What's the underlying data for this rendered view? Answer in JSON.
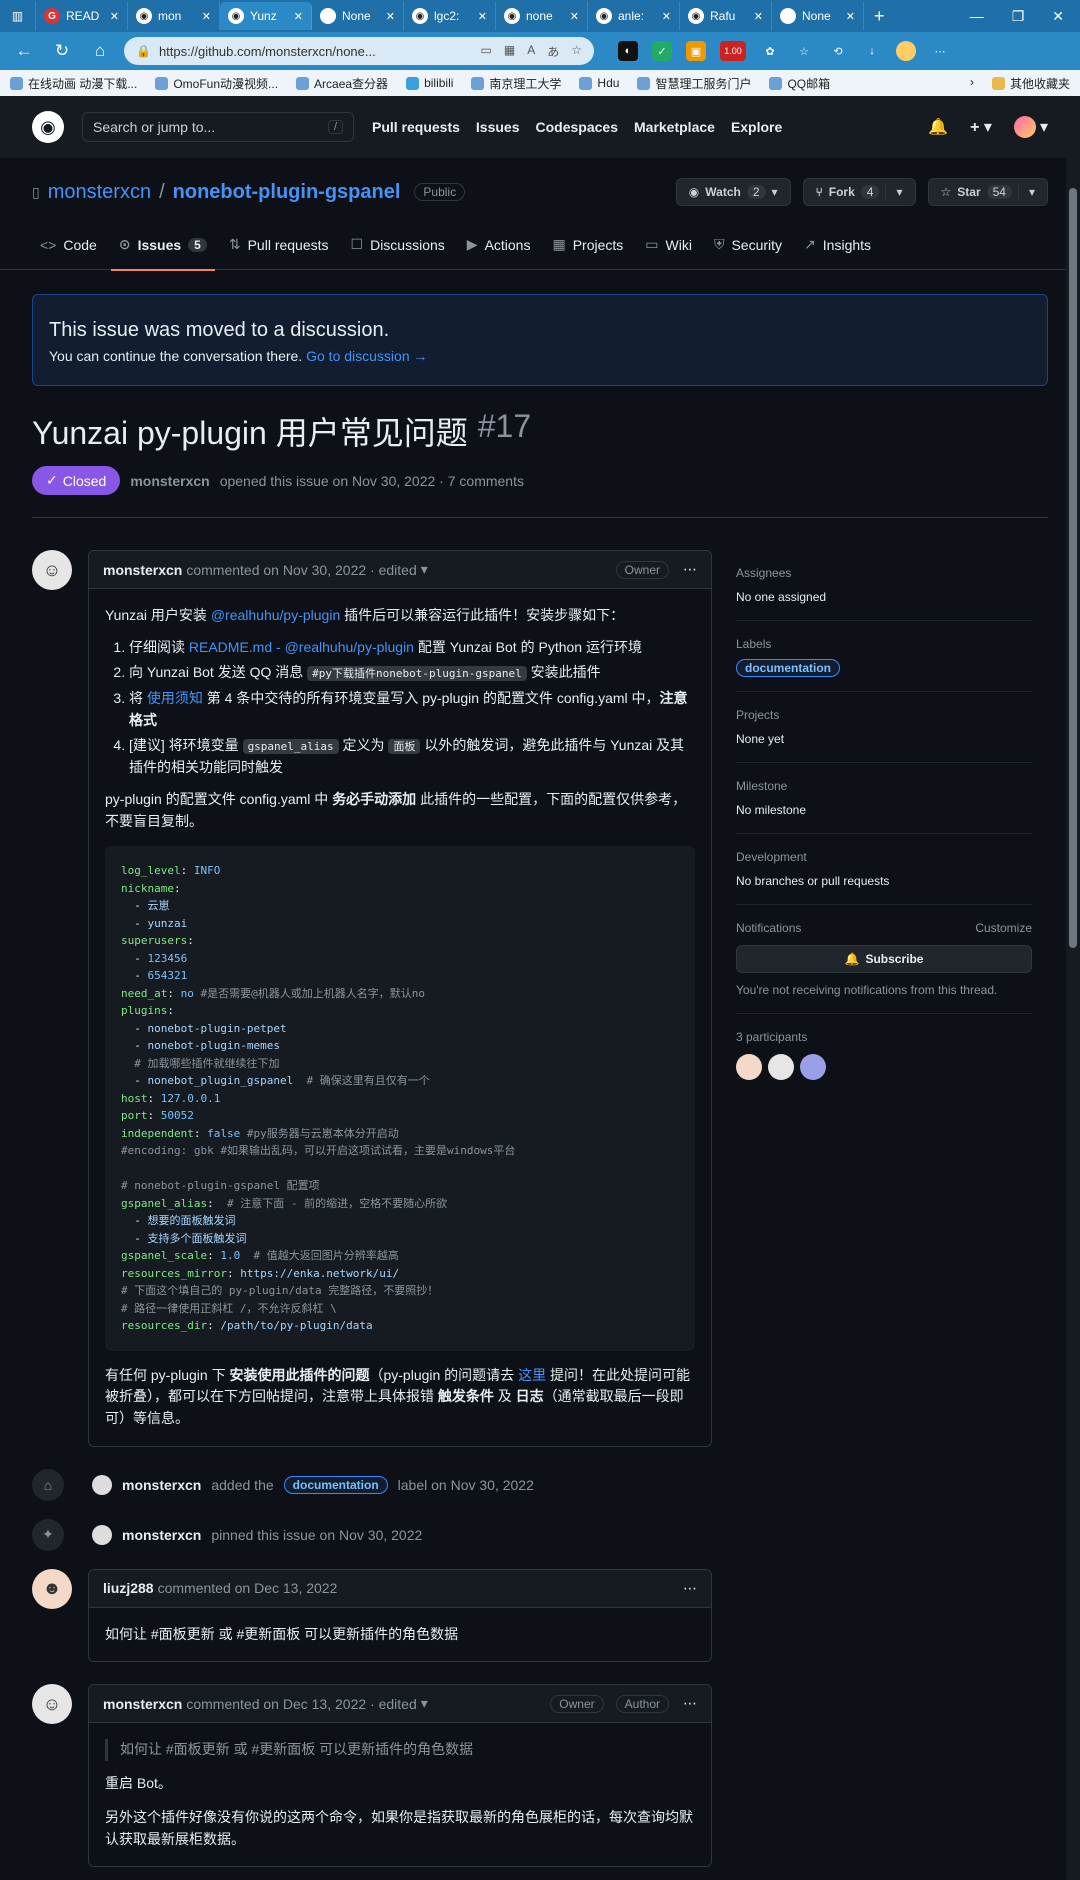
{
  "browser": {
    "tabs": [
      {
        "label": "READ",
        "icon": "G",
        "active": false
      },
      {
        "label": "mon",
        "icon": "◉",
        "active": false
      },
      {
        "label": "Yunz",
        "icon": "◉",
        "active": true
      },
      {
        "label": "None",
        "icon": "",
        "active": false
      },
      {
        "label": "lgc2:",
        "icon": "◉",
        "active": false
      },
      {
        "label": "none",
        "icon": "◉",
        "active": false
      },
      {
        "label": "anle:",
        "icon": "◉",
        "active": false
      },
      {
        "label": "Rafu",
        "icon": "◉",
        "active": false
      },
      {
        "label": "None",
        "icon": "",
        "active": false
      }
    ],
    "url": "https://github.com/monsterxcn/none...",
    "bookmarks": [
      "在线动画 动漫下载...",
      "OmoFun动漫视频...",
      "Arcaea查分器",
      "bilibili",
      "南京理工大学",
      "Hdu",
      "智慧理工服务门户",
      "QQ邮箱"
    ],
    "bookmarks_more": "其他收藏夹",
    "ext_badge": "1.00"
  },
  "gh": {
    "search_placeholder": "Search or jump to...",
    "search_key": "/",
    "nav": [
      "Pull requests",
      "Issues",
      "Codespaces",
      "Marketplace",
      "Explore"
    ]
  },
  "repo": {
    "owner": "monsterxcn",
    "sep": "/",
    "name": "nonebot-plugin-gspanel",
    "visibility": "Public",
    "watch_label": "Watch",
    "watch_count": "2",
    "fork_label": "Fork",
    "fork_count": "4",
    "star_label": "Star",
    "star_count": "54",
    "tabs": [
      {
        "label": "Code",
        "icon": "<>"
      },
      {
        "label": "Issues",
        "icon": "⊙",
        "count": "5",
        "active": true
      },
      {
        "label": "Pull requests",
        "icon": "⇅"
      },
      {
        "label": "Discussions",
        "icon": "☐"
      },
      {
        "label": "Actions",
        "icon": "▶"
      },
      {
        "label": "Projects",
        "icon": "▦"
      },
      {
        "label": "Wiki",
        "icon": "▭"
      },
      {
        "label": "Security",
        "icon": "⛨"
      },
      {
        "label": "Insights",
        "icon": "↗"
      }
    ]
  },
  "moved": {
    "title": "This issue was moved to a discussion.",
    "text": "You can continue the conversation there.",
    "link": "Go to discussion →"
  },
  "issue": {
    "title": "Yunzai py-plugin 用户常见问题",
    "number": "#17",
    "state": "Closed",
    "author": "monsterxcn",
    "opened_text": "opened this issue on Nov 30, 2022 · 7 comments"
  },
  "comment1": {
    "author": "monsterxcn",
    "meta": "commented on Nov 30, 2022 · edited",
    "role": "Owner",
    "intro_pre": "Yunzai 用户安装 ",
    "intro_link": "@realhuhu/py-plugin",
    "intro_post": " 插件后可以兼容运行此插件！安装步骤如下：",
    "step1_pre": "仔细阅读 ",
    "step1_link": "README.md - @realhuhu/py-plugin",
    "step1_post": " 配置 Yunzai Bot 的 Python 运行环境",
    "step2_pre": "向 Yunzai Bot 发送 QQ 消息 ",
    "step2_code": "#py下载插件nonebot-plugin-gspanel",
    "step2_post": " 安装此插件",
    "step3_pre": "将 ",
    "step3_link": "使用须知",
    "step3_mid": " 第 4 条中交待的所有环境变量写入 py-plugin 的配置文件 config.yaml 中，",
    "step3_bold": "注意格式",
    "step4_pre": "[建议] 将环境变量 ",
    "step4_code1": "gspanel_alias",
    "step4_mid": " 定义为 ",
    "step4_code2": "面板",
    "step4_post": " 以外的触发词，避免此插件与 Yunzai 及其插件的相关功能同时触发",
    "para2_pre": "py-plugin 的配置文件 config.yaml 中 ",
    "para2_bold": "务必手动添加",
    "para2_post": " 此插件的一些配置，下面的配置仅供参考，不要盲目复制。",
    "para3_pre": "有任何 py-plugin 下 ",
    "para3_bold": "安装使用此插件的问题",
    "para3_mid": "（py-plugin 的问题请去 ",
    "para3_link": "这里",
    "para3_mid2": " 提问！在此处提问可能被折叠），都可以在下方回帖提问，注意带上具体报错 ",
    "para3_b2": "触发条件",
    "para3_and": " 及 ",
    "para3_b3": "日志",
    "para3_post": "（通常截取最后一段即可）等信息。"
  },
  "events": [
    {
      "actor": "monsterxcn",
      "pre": "added the",
      "label": "documentation",
      "post": "label on Nov 30, 2022",
      "icon": "tag-icon"
    },
    {
      "actor": "monsterxcn",
      "pre": "pinned this issue on Nov 30, 2022",
      "label": "",
      "post": "",
      "icon": "pin-icon"
    }
  ],
  "comment2": {
    "author": "liuzj288",
    "meta": "commented on Dec 13, 2022",
    "body": "如何让 #面板更新 或 #更新面板 可以更新插件的角色数据"
  },
  "comment3": {
    "author": "monsterxcn",
    "meta": "commented on Dec 13, 2022 · edited",
    "role1": "Owner",
    "role2": "Author",
    "quote": "如何让 #面板更新 或 #更新面板 可以更新插件的角色数据",
    "p1": "重启 Bot。",
    "p2": "另外这个插件好像没有你说的这两个命令，如果你是指获取最新的角色展柜的话，每次查询均默认获取最新展柜数据。"
  },
  "sidebar": {
    "assignees_h": "Assignees",
    "assignees": "No one assigned",
    "labels_h": "Labels",
    "label": "documentation",
    "projects_h": "Projects",
    "projects": "None yet",
    "milestone_h": "Milestone",
    "milestone": "No milestone",
    "dev_h": "Development",
    "dev": "No branches or pull requests",
    "notif_h": "Notifications",
    "customize": "Customize",
    "subscribe": "Subscribe",
    "notif_text": "You're not receiving notifications from this thread.",
    "participants": "3 participants"
  }
}
